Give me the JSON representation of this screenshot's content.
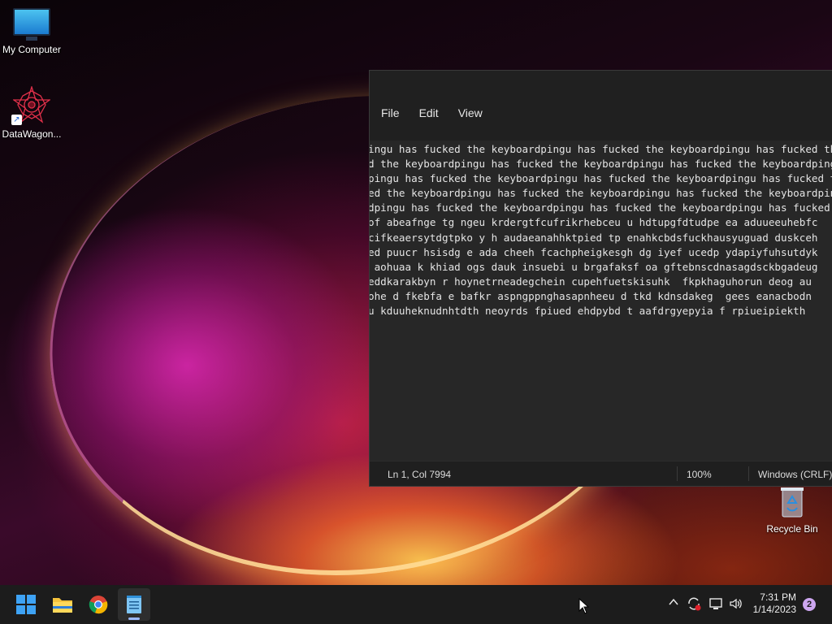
{
  "desktop": {
    "icons": [
      {
        "label": "My Computer",
        "icon": "monitor-icon"
      },
      {
        "label": "DataWagon...",
        "icon": "datawagon-star-icon"
      },
      {
        "label": "Recycle Bin",
        "icon": "recycle-bin-icon"
      }
    ]
  },
  "notepad": {
    "menu": [
      "File",
      "Edit",
      "View"
    ],
    "lines": [
      "ingu has fucked the keyboardpingu has fucked the keyboardpingu has fucked the keyboard",
      "d the keyboardpingu has fucked the keyboardpingu has fucked the keyboardpingu has fucked",
      "pingu has fucked the keyboardpingu has fucked the keyboardpingu has fucked the keyboard",
      "ed the keyboardpingu has fucked the keyboardpingu has fucked the keyboardpingu has fucke",
      "dpingu has fucked the keyboardpingu has fucked the keyboardpingu has fucked the keyboar",
      "of abeafnge tg ngeu krdergtfcufrikrhebceu u hdtupgfdtudpe ea aduueeuhebfc",
      "cifkeaersytdgtpko y h audaeanahhktpied tp enahkcbdsfuckhausyuguad duskceh",
      "ed puucr hsisdg e ada cheeh fcachpheigkesgh dg iyef ucedp ydapiyfuhsutdyk",
      " aohuaa k khiad ogs dauk insuebi u brgafaksf oa gftebnscdnasagdsckbgadeug",
      "eddkarakbyn r hoynetrneadegchein cupehfuetskisuhk  fkpkhaguhorun deog au",
      "ohe d fkebfa e bafkr aspngppnghasapnheeu d tkd kdnsdakeg  gees eanacbodn",
      "u kduuheknudnhtdth neoyrds fpiued ehdpybd t aafdrgyepyia f rpiueipiekth"
    ],
    "status": {
      "position": "Ln 1, Col 7994",
      "zoom": "100%",
      "line_endings": "Windows (CRLF)"
    }
  },
  "taskbar": {
    "apps": [
      {
        "name": "start-button",
        "icon": "windows-logo-icon"
      },
      {
        "name": "file-explorer",
        "icon": "folder-icon"
      },
      {
        "name": "chrome",
        "icon": "chrome-icon"
      },
      {
        "name": "notepad",
        "icon": "notepad-icon"
      }
    ],
    "tray_icons": [
      "chevron-up-icon",
      "sync-icon",
      "network-icon",
      "volume-icon"
    ],
    "clock": {
      "time": "7:31 PM",
      "date": "1/14/2023"
    },
    "notification_count": "2"
  }
}
